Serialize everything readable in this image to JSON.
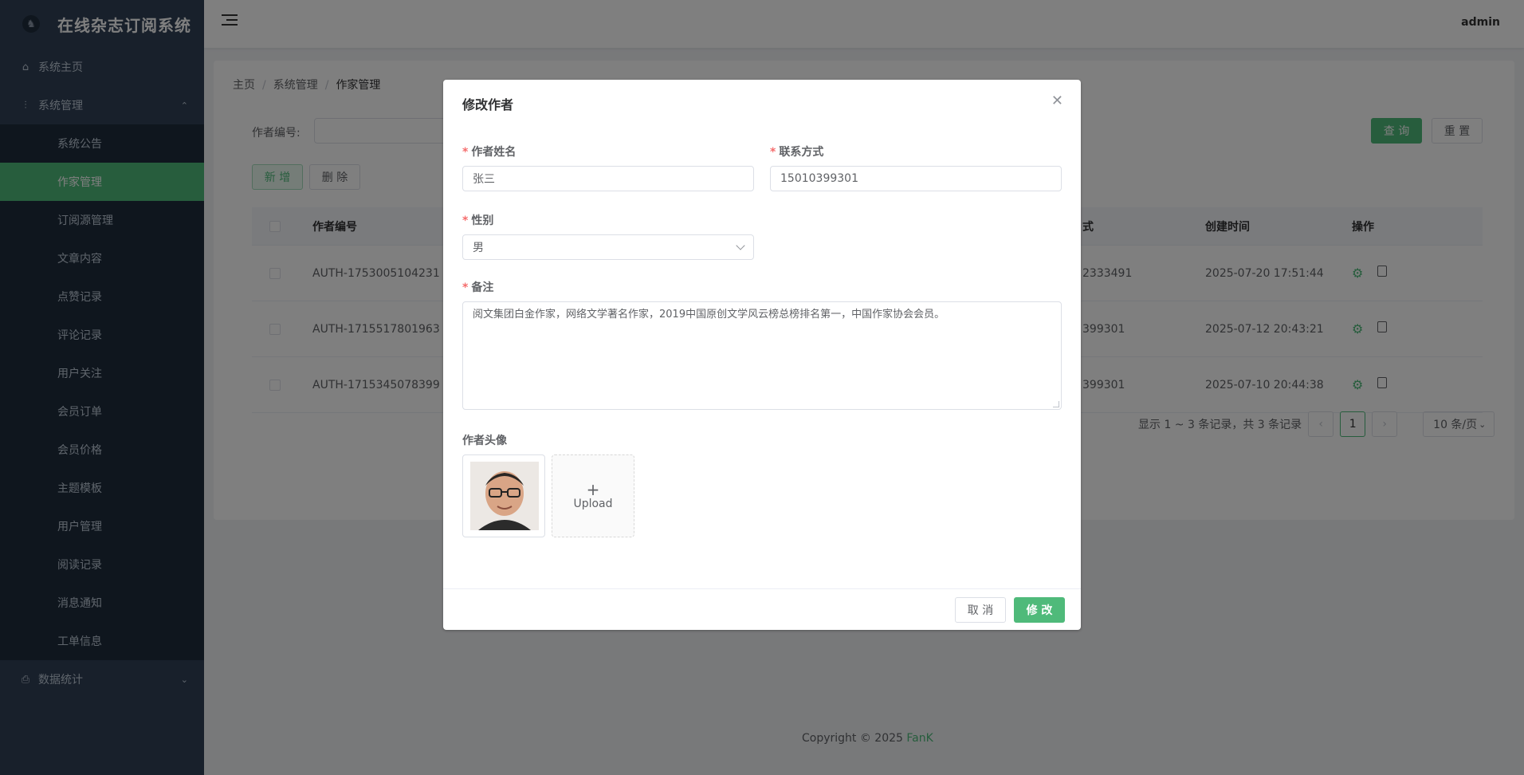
{
  "brand": {
    "title": "在线杂志订阅系统",
    "logo_icon": "user-avatar-icon"
  },
  "sidebar": {
    "items": [
      {
        "label": "系统主页",
        "icon": "home-icon"
      },
      {
        "label": "系统管理",
        "icon": "sliders-icon",
        "expanded": true,
        "children": [
          "系统公告",
          "作家管理",
          "订阅源管理",
          "文章内容",
          "点赞记录",
          "评论记录",
          "用户关注",
          "会员订单",
          "会员价格",
          "主题模板",
          "用户管理",
          "阅读记录",
          "消息通知",
          "工单信息"
        ],
        "active_child": "作家管理"
      },
      {
        "label": "数据统计",
        "icon": "printer-icon",
        "expanded": false
      }
    ]
  },
  "header": {
    "user": "admin"
  },
  "breadcrumb": {
    "home": "主页",
    "section": "系统管理",
    "current": "作家管理"
  },
  "search": {
    "label": "作者编号:",
    "value": "",
    "query_label": "查 询",
    "reset_label": "重 置"
  },
  "toolbar": {
    "add_label": "新 增",
    "delete_label": "删 除"
  },
  "table": {
    "headers": {
      "id": "作者编号",
      "phone": "式",
      "created": "创建时间",
      "ops": "操作"
    },
    "rows": [
      {
        "id": "AUTH-1753005104231",
        "phone": "2333491",
        "created": "2025-07-20 17:51:44"
      },
      {
        "id": "AUTH-1715517801963",
        "phone": "399301",
        "created": "2025-07-12 20:43:21"
      },
      {
        "id": "AUTH-1715345078399",
        "phone": "399301",
        "created": "2025-07-10 20:44:38"
      }
    ]
  },
  "pagination": {
    "summary": "显示 1 ~ 3 条记录，共 3 条记录",
    "current_page": "1",
    "page_size": "10 条/页"
  },
  "footer": {
    "copyright": "Copyright © 2025",
    "brand": "FanK"
  },
  "dialog": {
    "title": "修改作者",
    "fields": {
      "name": {
        "label": "作者姓名",
        "value": "张三"
      },
      "contact": {
        "label": "联系方式",
        "value": "15010399301"
      },
      "gender": {
        "label": "性别",
        "value": "男"
      },
      "remark": {
        "label": "备注",
        "value": "阅文集团白金作家，网络文学著名作家，2019中国原创文学风云榜总榜排名第一，中国作家协会会员。"
      },
      "avatar": {
        "label": "作者头像",
        "upload_label": "Upload"
      }
    },
    "cancel_label": "取 消",
    "submit_label": "修 改"
  },
  "colors": {
    "accent": "#4fba7a",
    "sidebar": "#304156",
    "required": "#f56c6c"
  }
}
